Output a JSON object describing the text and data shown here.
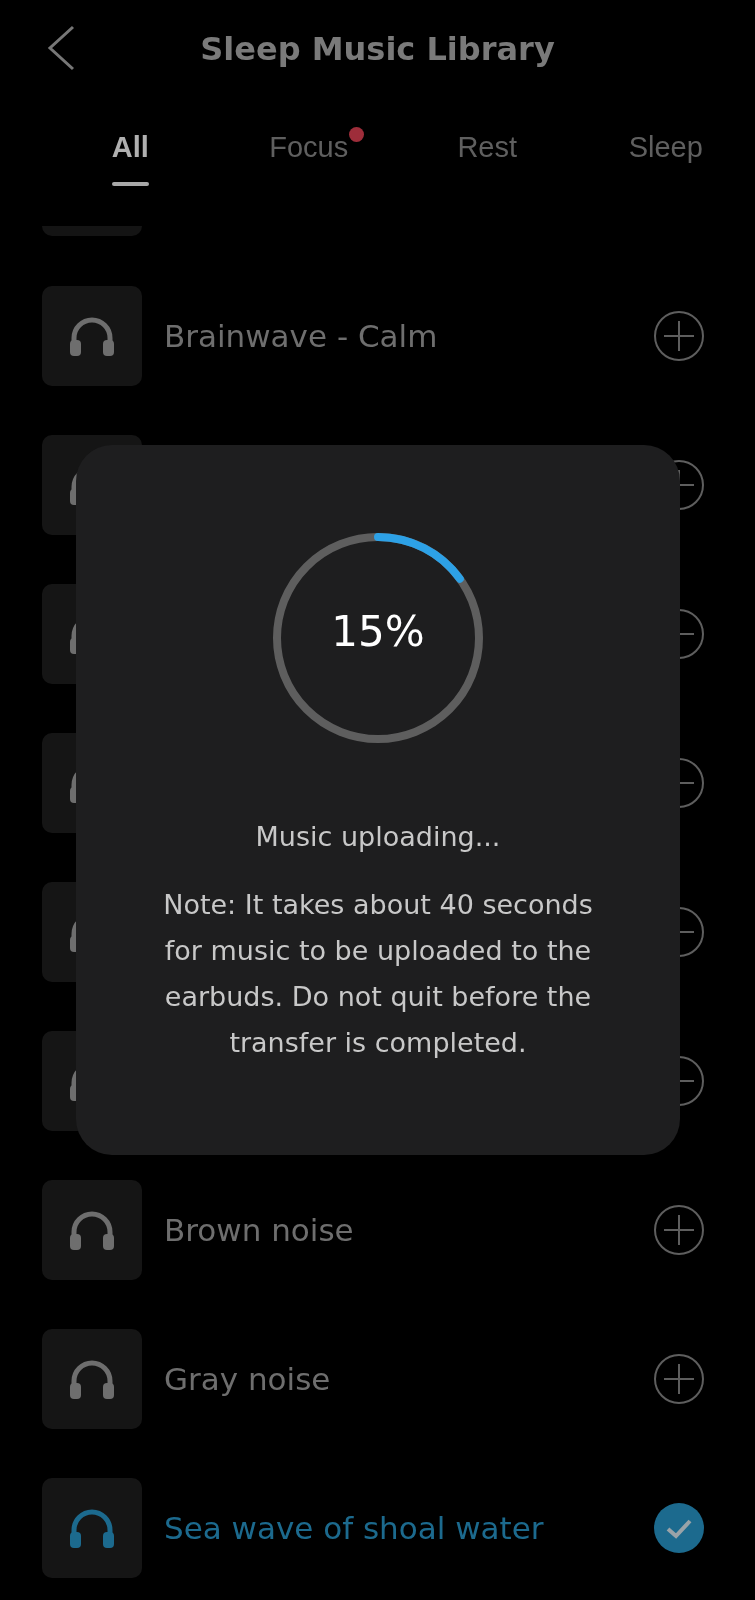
{
  "header": {
    "title": "Sleep Music Library"
  },
  "tabs": [
    {
      "label": "All",
      "selected": true,
      "dot": false
    },
    {
      "label": "Focus",
      "selected": false,
      "dot": true
    },
    {
      "label": "Rest",
      "selected": false,
      "dot": false
    },
    {
      "label": "Sleep",
      "selected": false,
      "dot": false
    }
  ],
  "tracks": [
    {
      "title": "Brainwave - Calm",
      "added": false
    },
    {
      "added": false
    },
    {
      "added": false
    },
    {
      "added": false
    },
    {
      "added": false
    },
    {
      "added": false
    },
    {
      "title": "Brown noise",
      "added": false
    },
    {
      "title": "Gray noise",
      "added": false
    },
    {
      "title": "Sea wave of shoal water",
      "added": true
    }
  ],
  "upload_dialog": {
    "level": 0.15,
    "percent": "15%",
    "status": "Music uploading...",
    "note": "Note: It takes about 40 seconds for music to be uploaded to the earbuds. Do not quit before the transfer is completed."
  }
}
